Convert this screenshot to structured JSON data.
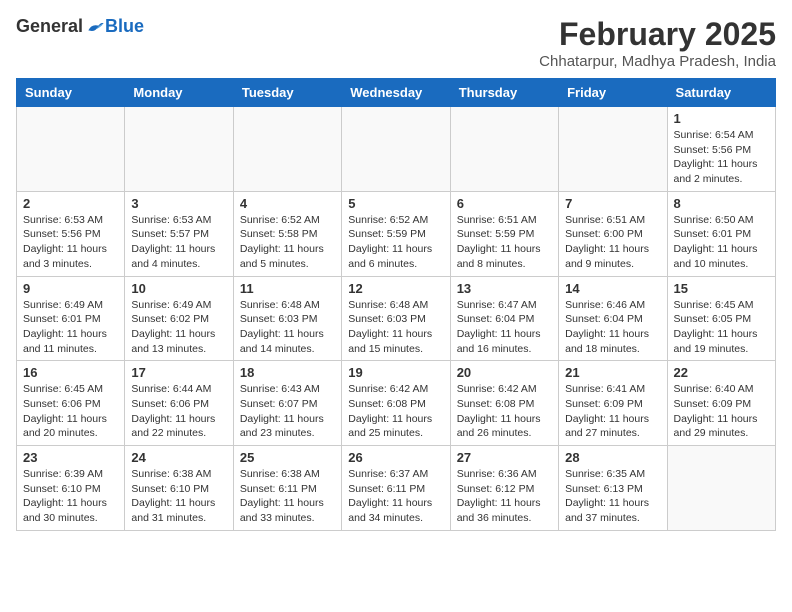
{
  "header": {
    "logo_general": "General",
    "logo_blue": "Blue",
    "month_year": "February 2025",
    "location": "Chhatarpur, Madhya Pradesh, India"
  },
  "weekdays": [
    "Sunday",
    "Monday",
    "Tuesday",
    "Wednesday",
    "Thursday",
    "Friday",
    "Saturday"
  ],
  "weeks": [
    [
      {
        "day": "",
        "info": ""
      },
      {
        "day": "",
        "info": ""
      },
      {
        "day": "",
        "info": ""
      },
      {
        "day": "",
        "info": ""
      },
      {
        "day": "",
        "info": ""
      },
      {
        "day": "",
        "info": ""
      },
      {
        "day": "1",
        "info": "Sunrise: 6:54 AM\nSunset: 5:56 PM\nDaylight: 11 hours and 2 minutes."
      }
    ],
    [
      {
        "day": "2",
        "info": "Sunrise: 6:53 AM\nSunset: 5:56 PM\nDaylight: 11 hours and 3 minutes."
      },
      {
        "day": "3",
        "info": "Sunrise: 6:53 AM\nSunset: 5:57 PM\nDaylight: 11 hours and 4 minutes."
      },
      {
        "day": "4",
        "info": "Sunrise: 6:52 AM\nSunset: 5:58 PM\nDaylight: 11 hours and 5 minutes."
      },
      {
        "day": "5",
        "info": "Sunrise: 6:52 AM\nSunset: 5:59 PM\nDaylight: 11 hours and 6 minutes."
      },
      {
        "day": "6",
        "info": "Sunrise: 6:51 AM\nSunset: 5:59 PM\nDaylight: 11 hours and 8 minutes."
      },
      {
        "day": "7",
        "info": "Sunrise: 6:51 AM\nSunset: 6:00 PM\nDaylight: 11 hours and 9 minutes."
      },
      {
        "day": "8",
        "info": "Sunrise: 6:50 AM\nSunset: 6:01 PM\nDaylight: 11 hours and 10 minutes."
      }
    ],
    [
      {
        "day": "9",
        "info": "Sunrise: 6:49 AM\nSunset: 6:01 PM\nDaylight: 11 hours and 11 minutes."
      },
      {
        "day": "10",
        "info": "Sunrise: 6:49 AM\nSunset: 6:02 PM\nDaylight: 11 hours and 13 minutes."
      },
      {
        "day": "11",
        "info": "Sunrise: 6:48 AM\nSunset: 6:03 PM\nDaylight: 11 hours and 14 minutes."
      },
      {
        "day": "12",
        "info": "Sunrise: 6:48 AM\nSunset: 6:03 PM\nDaylight: 11 hours and 15 minutes."
      },
      {
        "day": "13",
        "info": "Sunrise: 6:47 AM\nSunset: 6:04 PM\nDaylight: 11 hours and 16 minutes."
      },
      {
        "day": "14",
        "info": "Sunrise: 6:46 AM\nSunset: 6:04 PM\nDaylight: 11 hours and 18 minutes."
      },
      {
        "day": "15",
        "info": "Sunrise: 6:45 AM\nSunset: 6:05 PM\nDaylight: 11 hours and 19 minutes."
      }
    ],
    [
      {
        "day": "16",
        "info": "Sunrise: 6:45 AM\nSunset: 6:06 PM\nDaylight: 11 hours and 20 minutes."
      },
      {
        "day": "17",
        "info": "Sunrise: 6:44 AM\nSunset: 6:06 PM\nDaylight: 11 hours and 22 minutes."
      },
      {
        "day": "18",
        "info": "Sunrise: 6:43 AM\nSunset: 6:07 PM\nDaylight: 11 hours and 23 minutes."
      },
      {
        "day": "19",
        "info": "Sunrise: 6:42 AM\nSunset: 6:08 PM\nDaylight: 11 hours and 25 minutes."
      },
      {
        "day": "20",
        "info": "Sunrise: 6:42 AM\nSunset: 6:08 PM\nDaylight: 11 hours and 26 minutes."
      },
      {
        "day": "21",
        "info": "Sunrise: 6:41 AM\nSunset: 6:09 PM\nDaylight: 11 hours and 27 minutes."
      },
      {
        "day": "22",
        "info": "Sunrise: 6:40 AM\nSunset: 6:09 PM\nDaylight: 11 hours and 29 minutes."
      }
    ],
    [
      {
        "day": "23",
        "info": "Sunrise: 6:39 AM\nSunset: 6:10 PM\nDaylight: 11 hours and 30 minutes."
      },
      {
        "day": "24",
        "info": "Sunrise: 6:38 AM\nSunset: 6:10 PM\nDaylight: 11 hours and 31 minutes."
      },
      {
        "day": "25",
        "info": "Sunrise: 6:38 AM\nSunset: 6:11 PM\nDaylight: 11 hours and 33 minutes."
      },
      {
        "day": "26",
        "info": "Sunrise: 6:37 AM\nSunset: 6:11 PM\nDaylight: 11 hours and 34 minutes."
      },
      {
        "day": "27",
        "info": "Sunrise: 6:36 AM\nSunset: 6:12 PM\nDaylight: 11 hours and 36 minutes."
      },
      {
        "day": "28",
        "info": "Sunrise: 6:35 AM\nSunset: 6:13 PM\nDaylight: 11 hours and 37 minutes."
      },
      {
        "day": "",
        "info": ""
      }
    ]
  ]
}
